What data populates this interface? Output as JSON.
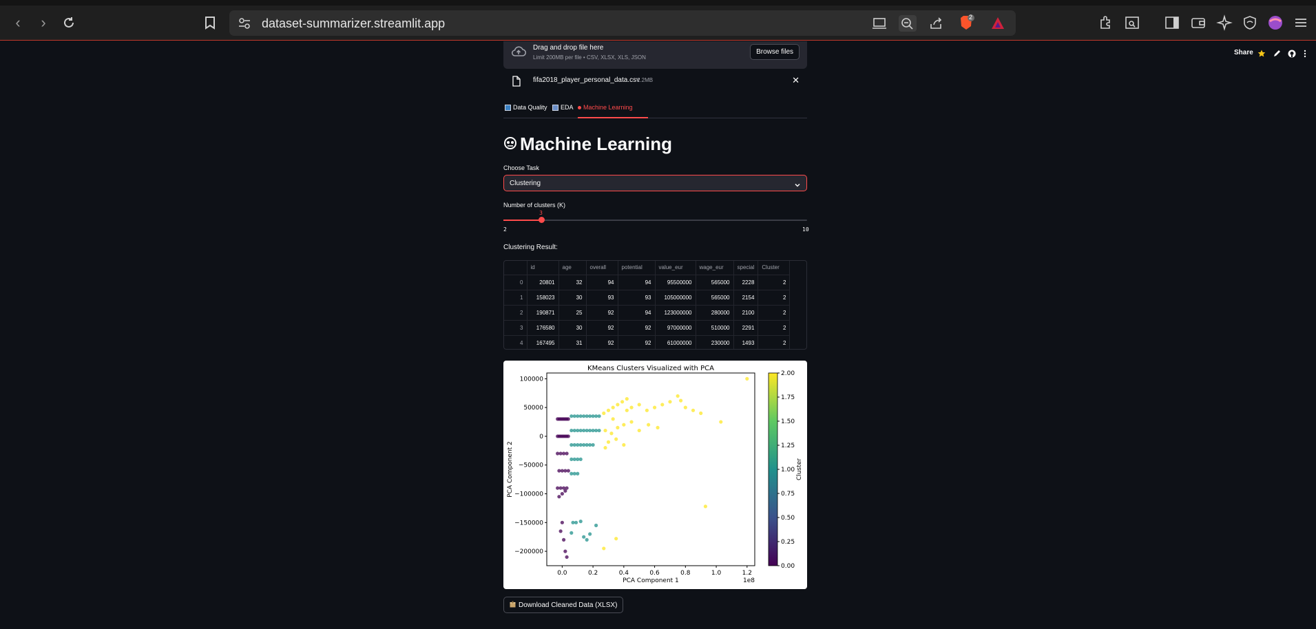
{
  "browser": {
    "url": "dataset-summarizer.streamlit.app",
    "brave_badge": "2"
  },
  "app_header": {
    "share_label": "Share"
  },
  "uploader": {
    "drag_drop_text": "Drag and drop file here",
    "limit_text": "Limit 200MB per file • CSV, XLSX, XLS, JSON",
    "browse_label": "Browse files",
    "file_name": "fifa2018_player_personal_data.csv",
    "file_size": "1.2MB"
  },
  "tabs": [
    {
      "label": "Data Quality",
      "icon": "bar-chart-icon"
    },
    {
      "label": "EDA",
      "icon": "chart-icon"
    },
    {
      "label": "Machine Learning",
      "icon": "red-dot-icon",
      "active": true
    }
  ],
  "section": {
    "title": "Machine Learning",
    "title_icon": "robot-face-icon"
  },
  "task_select": {
    "label": "Choose Task",
    "value": "Clustering"
  },
  "clusters_slider": {
    "label": "Number of clusters (K)",
    "value": "3",
    "min": "2",
    "max": "10",
    "level_fraction": 0.125
  },
  "result": {
    "label": "Clustering Result:",
    "columns": [
      "",
      "id",
      "age",
      "overall",
      "potential",
      "value_eur",
      "wage_eur",
      "special",
      "Cluster"
    ],
    "rows": [
      [
        "0",
        "20801",
        "32",
        "94",
        "94",
        "95500000",
        "565000",
        "2228",
        "2"
      ],
      [
        "1",
        "158023",
        "30",
        "93",
        "93",
        "105000000",
        "565000",
        "2154",
        "2"
      ],
      [
        "2",
        "190871",
        "25",
        "92",
        "94",
        "123000000",
        "280000",
        "2100",
        "2"
      ],
      [
        "3",
        "176580",
        "30",
        "92",
        "92",
        "97000000",
        "510000",
        "2291",
        "2"
      ],
      [
        "4",
        "167495",
        "31",
        "92",
        "92",
        "61000000",
        "230000",
        "1493",
        "2"
      ]
    ]
  },
  "download": {
    "label": "Download Cleaned Data (XLSX)",
    "icon": "package-icon"
  },
  "chart_data": {
    "type": "scatter",
    "title": "KMeans Clusters Visualized with PCA",
    "xlabel": "PCA Component 1",
    "ylabel": "PCA Component 2",
    "x_offset_label": "1e8",
    "xlim": [
      -0.1,
      1.25
    ],
    "ylim": [
      -225000,
      110000
    ],
    "xticks": [
      "0.0",
      "0.2",
      "0.4",
      "0.6",
      "0.8",
      "1.0",
      "1.2"
    ],
    "xtick_values": [
      0.0,
      0.2,
      0.4,
      0.6,
      0.8,
      1.0,
      1.2
    ],
    "yticks": [
      "100000",
      "50000",
      "0",
      "−50000",
      "−100000",
      "−150000",
      "−200000"
    ],
    "ytick_values": [
      100000,
      50000,
      0,
      -50000,
      -100000,
      -150000,
      -200000
    ],
    "colorbar": {
      "label": "Cluster",
      "ticks": [
        "0.00",
        "0.25",
        "0.50",
        "0.75",
        "1.00",
        "1.25",
        "1.50",
        "1.75",
        "2.00"
      ],
      "tick_values": [
        0,
        0.25,
        0.5,
        0.75,
        1.0,
        1.25,
        1.5,
        1.75,
        2.0
      ],
      "range": [
        0,
        2
      ]
    },
    "colors": {
      "cluster_0": "#440154",
      "cluster_1": "#21918c",
      "cluster_2": "#fde725"
    },
    "series": [
      {
        "name": "0",
        "x": [
          -0.03,
          -0.02,
          -0.01,
          0.0,
          0.01,
          0.02,
          0.03,
          0.04,
          -0.03,
          -0.02,
          -0.01,
          0.0,
          0.01,
          0.02,
          0.03,
          0.04,
          -0.03,
          -0.01,
          0.01,
          0.03,
          -0.02,
          0.0,
          0.02,
          0.04,
          -0.03,
          -0.01,
          0.01,
          0.03,
          -0.02,
          0.0,
          0.02,
          0.0,
          -0.01,
          0.01,
          0.02,
          0.03
        ],
        "y": [
          30000,
          30000,
          30000,
          30000,
          30000,
          30000,
          30000,
          30000,
          0,
          0,
          0,
          0,
          0,
          0,
          0,
          0,
          -30000,
          -30000,
          -30000,
          -30000,
          -60000,
          -60000,
          -60000,
          -60000,
          -90000,
          -90000,
          -90000,
          -90000,
          -105000,
          -100000,
          -95000,
          -150000,
          -165000,
          -180000,
          -200000,
          -210000
        ]
      },
      {
        "name": "1",
        "x": [
          0.06,
          0.08,
          0.1,
          0.12,
          0.14,
          0.16,
          0.18,
          0.2,
          0.22,
          0.24,
          0.06,
          0.08,
          0.1,
          0.12,
          0.14,
          0.16,
          0.18,
          0.2,
          0.22,
          0.24,
          0.06,
          0.08,
          0.1,
          0.12,
          0.14,
          0.16,
          0.18,
          0.2,
          0.06,
          0.08,
          0.1,
          0.12,
          0.06,
          0.08,
          0.1,
          0.07,
          0.09,
          0.12,
          0.14,
          0.18,
          0.22,
          0.16,
          0.06
        ],
        "y": [
          35000,
          35000,
          35000,
          35000,
          35000,
          35000,
          35000,
          35000,
          35000,
          35000,
          10000,
          10000,
          10000,
          10000,
          10000,
          10000,
          10000,
          10000,
          10000,
          10000,
          -15000,
          -15000,
          -15000,
          -15000,
          -15000,
          -15000,
          -15000,
          -15000,
          -40000,
          -40000,
          -40000,
          -40000,
          -65000,
          -65000,
          -65000,
          -150000,
          -150000,
          -148000,
          -175000,
          -170000,
          -155000,
          -180000,
          -168000
        ]
      },
      {
        "name": "2",
        "x": [
          0.27,
          0.3,
          0.33,
          0.36,
          0.39,
          0.42,
          0.45,
          0.5,
          0.55,
          0.6,
          0.65,
          0.7,
          0.75,
          0.8,
          0.85,
          0.9,
          1.03,
          1.2,
          0.28,
          0.32,
          0.36,
          0.4,
          0.45,
          0.5,
          0.56,
          0.62,
          0.3,
          0.35,
          0.4,
          0.28,
          0.33,
          0.77,
          0.93,
          0.35,
          0.27,
          0.42
        ],
        "y": [
          40000,
          45000,
          50000,
          55000,
          60000,
          65000,
          50000,
          55000,
          45000,
          50000,
          55000,
          60000,
          70000,
          50000,
          45000,
          40000,
          25000,
          100000,
          10000,
          5000,
          15000,
          20000,
          25000,
          10000,
          20000,
          15000,
          -10000,
          -5000,
          -15000,
          -20000,
          30000,
          62000,
          -122000,
          -178000,
          -195000,
          45000
        ]
      }
    ]
  }
}
